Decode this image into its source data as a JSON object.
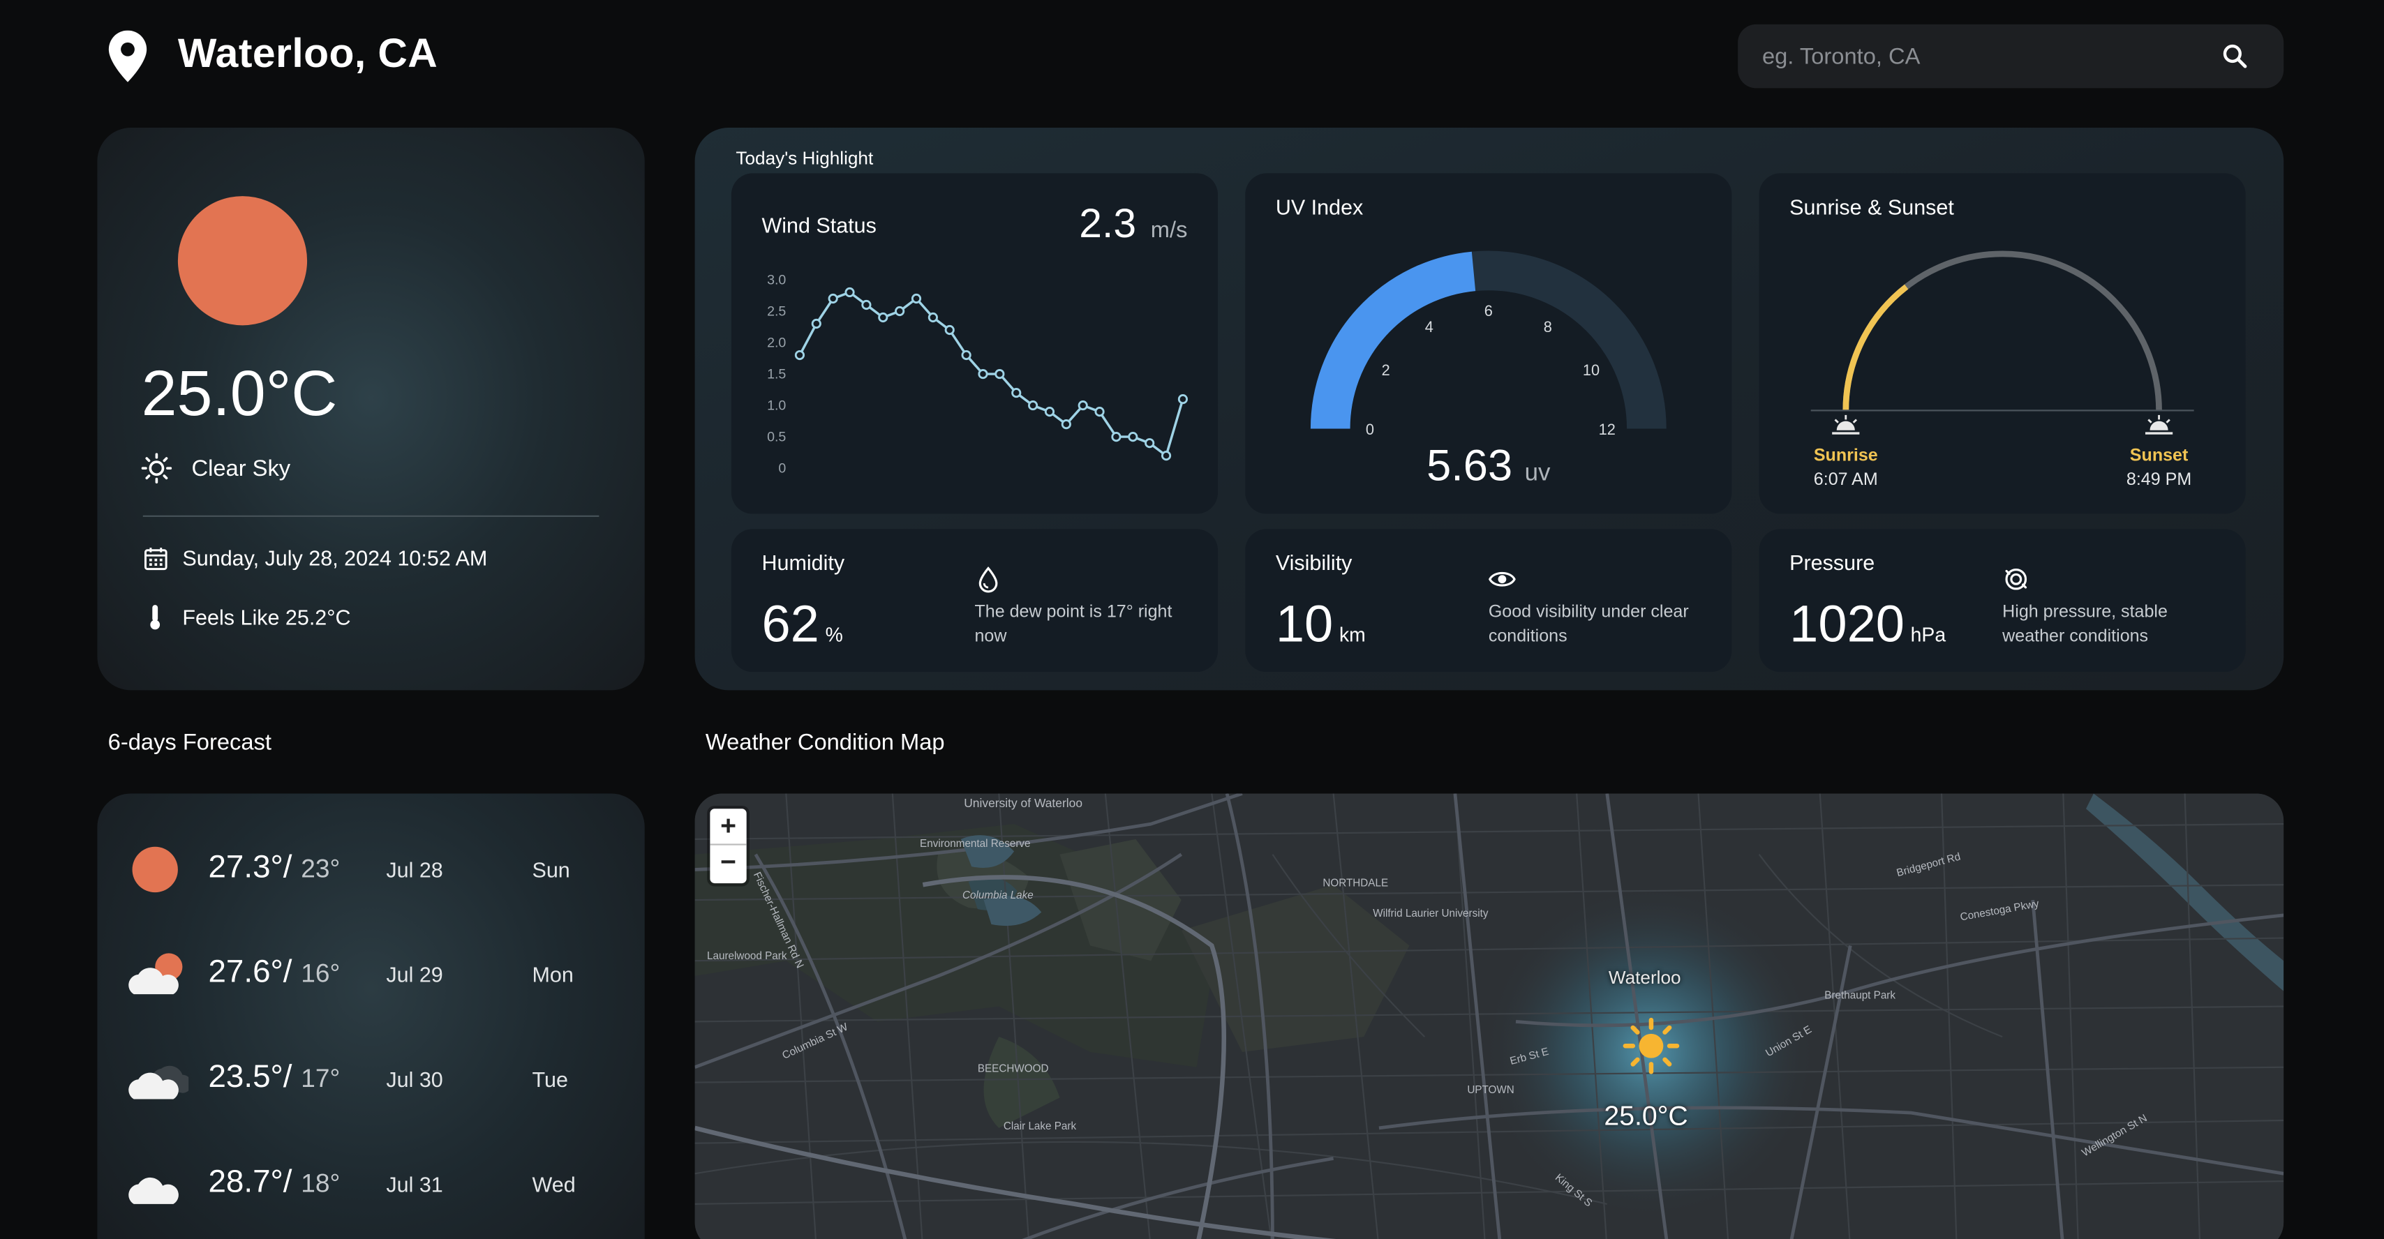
{
  "header": {
    "city": "Waterloo, CA",
    "search_placeholder": "eg. Toronto, CA",
    "pin_icon": "map-pin-icon",
    "search_icon": "search-icon"
  },
  "current": {
    "temp": "25.0°C",
    "condition": "Clear Sky",
    "datetime": "Sunday, July 28, 2024 10:52 AM",
    "feels_like": "Feels Like 25.2°C",
    "sun_color": "#e27452"
  },
  "highlights": {
    "title": "Today's Highlight",
    "wind": {
      "label": "Wind Status",
      "value": "2.3",
      "unit": "m/s"
    },
    "uv": {
      "label": "UV Index",
      "value": "5.63",
      "unit": "uv",
      "max": 12,
      "ticks": [
        "0",
        "2",
        "4",
        "6",
        "8",
        "10",
        "12"
      ],
      "fraction": 0.47
    },
    "sun": {
      "label": "Sunrise & Sunset",
      "sunrise_label": "Sunrise",
      "sunrise_time": "6:07 AM",
      "sunset_label": "Sunset",
      "sunset_time": "8:49 PM",
      "progress": 0.29
    },
    "humidity": {
      "label": "Humidity",
      "value": "62",
      "unit": "%",
      "note": "The dew point is 17° right now"
    },
    "visibility": {
      "label": "Visibility",
      "value": "10",
      "unit": "km",
      "note": "Good visibility under clear conditions"
    },
    "pressure": {
      "label": "Pressure",
      "value": "1020",
      "unit": "hPa",
      "note": "High pressure, stable weather conditions"
    }
  },
  "chart_data": {
    "type": "line",
    "title": "Wind Status",
    "xlabel": "",
    "ylabel": "",
    "ylim": [
      0,
      3.0
    ],
    "yticks": [
      "3.0",
      "2.5",
      "2.0",
      "1.5",
      "1.0",
      "0.5",
      "0"
    ],
    "values": [
      1.8,
      2.3,
      2.7,
      2.8,
      2.6,
      2.4,
      2.5,
      2.7,
      2.4,
      2.2,
      1.8,
      1.5,
      1.5,
      1.2,
      1.0,
      0.9,
      0.7,
      1.0,
      0.9,
      0.5,
      0.5,
      0.4,
      0.2,
      1.1
    ]
  },
  "forecast": {
    "title": "6-days Forecast",
    "days": [
      {
        "hi": "27.3°/",
        "lo": "23°",
        "date": "Jul 28",
        "day": "Sun",
        "icon": "sun-icon"
      },
      {
        "hi": "27.6°/",
        "lo": "16°",
        "date": "Jul 29",
        "day": "Mon",
        "icon": "partly-cloudy-icon"
      },
      {
        "hi": "23.5°/",
        "lo": "17°",
        "date": "Jul 30",
        "day": "Tue",
        "icon": "cloudy-icon"
      },
      {
        "hi": "28.7°/",
        "lo": "18°",
        "date": "Jul 31",
        "day": "Wed",
        "icon": "cloud-icon"
      }
    ]
  },
  "map": {
    "title": "Weather Condition Map",
    "zoom_in": "+",
    "zoom_out": "−",
    "city_label": "Waterloo",
    "temp_label": "25.0°C",
    "labels": [
      "University of Waterloo",
      "Environmental Reserve",
      "Columbia Lake",
      "Laurelwood Park",
      "BEECHWOOD",
      "Clair Lake Park",
      "NORTHDALE",
      "Wilfrid Laurier University",
      "UPTOWN",
      "Brethaupt Park",
      "Columbia St W",
      "Fischer-Hallman Rd N",
      "Erb St E",
      "Union St E",
      "King St S",
      "Bridgeport Rd",
      "Conestoga Pkwy",
      "Wellington St N"
    ]
  }
}
